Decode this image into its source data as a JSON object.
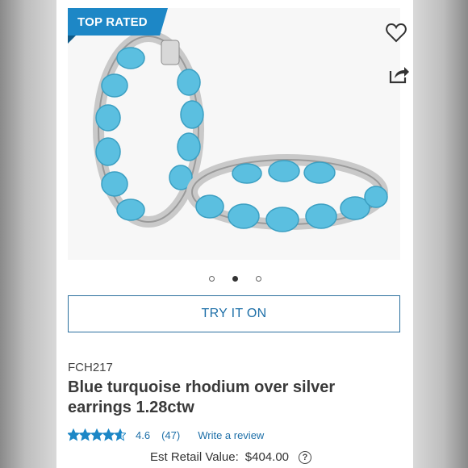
{
  "badge": {
    "label": "TOP RATED",
    "color": "#1d87c6"
  },
  "actions": {
    "favorite_icon": "heart-outline-icon",
    "share_icon": "share-icon"
  },
  "gallery": {
    "slide_count": 3,
    "active_index": 1
  },
  "try_on": {
    "label": "TRY IT ON"
  },
  "product": {
    "sku": "FCH217",
    "title_line1": "Blue turquoise rhodium over silver",
    "title_line2": "earrings 1.28ctw"
  },
  "rating": {
    "stars": 4.6,
    "value": "4.6",
    "count": "(47)",
    "write_review": "Write a review",
    "star_color": "#1d87c6"
  },
  "retail": {
    "label": "Est Retail Value:",
    "value": "$404.00",
    "help_icon": "question-circle-icon"
  }
}
